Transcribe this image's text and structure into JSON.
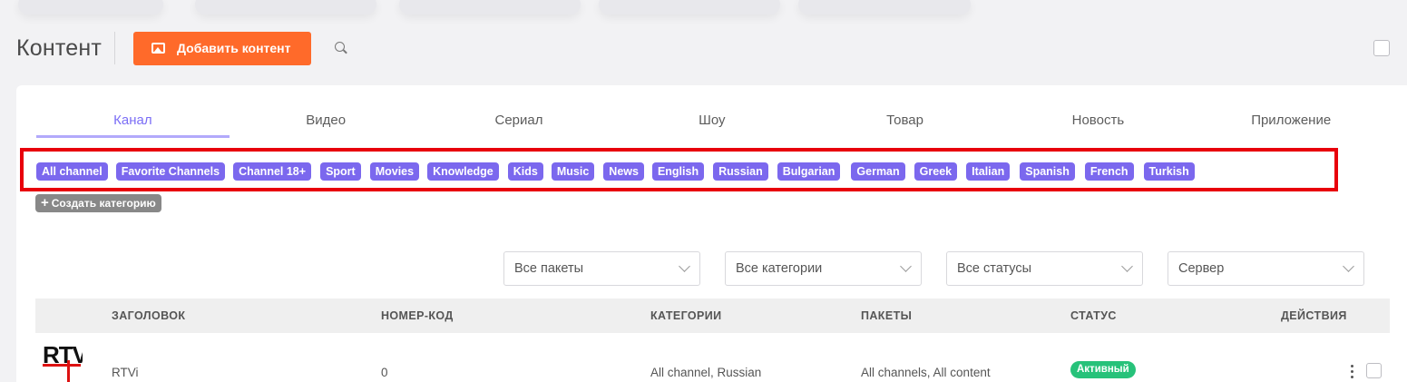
{
  "header": {
    "title": "Контент",
    "add_button": "Добавить контент"
  },
  "tabs": [
    "Канал",
    "Видео",
    "Сериал",
    "Шоу",
    "Товар",
    "Новость",
    "Приложение"
  ],
  "categories": [
    "All channel",
    "Favorite Channels",
    "Channel 18+",
    "Sport",
    "Movies",
    "Knowledge",
    "Kids",
    "Music",
    "News",
    "English",
    "Russian",
    "Bulgarian",
    "German",
    "Greek",
    "Italian",
    "Spanish",
    "French",
    "Turkish"
  ],
  "add_category": "Создать категорию",
  "filters": {
    "packages": "Все пакеты",
    "categories": "Все категории",
    "statuses": "Все статусы",
    "server": "Сервер"
  },
  "table": {
    "headers": {
      "title": "ЗАГОЛОВОК",
      "code": "НОМЕР-КОД",
      "categories": "КАТЕГОРИИ",
      "packages": "ПАКЕТЫ",
      "status": "СТАТУС",
      "actions": "ДЕЙСТВИЯ"
    },
    "rows": [
      {
        "logo_text": "RTV",
        "title": "RTVi",
        "code": "0",
        "categories": "All channel, Russian",
        "packages": "All channels, All content",
        "status": "Активный"
      }
    ]
  },
  "colors": {
    "accent": "#7b68ee",
    "add_button": "#ff6a2a",
    "status_active": "#27c27a",
    "highlight_frame": "#e8000b"
  }
}
